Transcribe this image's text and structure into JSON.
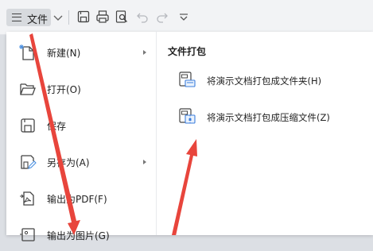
{
  "toolbar": {
    "file_label": "文件",
    "icons": [
      "menu-icon",
      "chevron-down-icon",
      "save-icon",
      "print-icon",
      "print-preview-icon",
      "undo-icon",
      "redo-icon",
      "customize-icon"
    ]
  },
  "file_menu": {
    "items": [
      {
        "label": "新建(N)",
        "icon": "new-file-icon",
        "submenu": true
      },
      {
        "label": "打开(O)",
        "icon": "folder-open-icon",
        "submenu": false
      },
      {
        "label": "保存",
        "icon": "save-icon",
        "submenu": false
      },
      {
        "label": "另存为(A)",
        "icon": "save-as-icon",
        "submenu": true
      },
      {
        "label": "输出为PDF(F)",
        "icon": "export-pdf-icon",
        "submenu": false
      },
      {
        "label": "输出为图片(G)",
        "icon": "export-image-icon",
        "submenu": false
      }
    ]
  },
  "submenu": {
    "title": "文件打包",
    "items": [
      {
        "label": "将演示文档打包成文件夹(H)",
        "icon": "package-folder-icon"
      },
      {
        "label": "将演示文档打包成压缩文件(Z)",
        "icon": "package-zip-icon"
      }
    ]
  },
  "annotation_color": "#e8453c"
}
